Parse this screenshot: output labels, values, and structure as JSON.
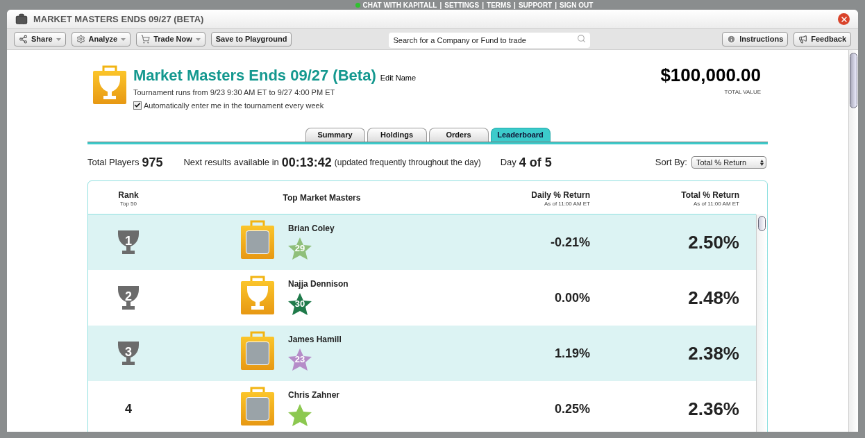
{
  "top_links": [
    "CHAT WITH KAPITALL",
    "SETTINGS",
    "TERMS",
    "SUPPORT",
    "SIGN OUT"
  ],
  "top_links_separator": "|",
  "window": {
    "title": "MARKET MASTERS ENDS 09/27 (BETA)"
  },
  "toolbar": {
    "buttons": [
      {
        "label": "Share",
        "kind": "share",
        "menu": true
      },
      {
        "label": "Analyze",
        "kind": "analyze",
        "menu": true
      },
      {
        "label": "Trade Now",
        "kind": "trade",
        "menu": true
      },
      {
        "label": "Save to Playground",
        "kind": "plain",
        "menu": false
      }
    ],
    "search": {
      "placeholder": "Search for a Company or Fund to trade"
    },
    "right_buttons": [
      {
        "label": "Instructions",
        "kind": "info"
      },
      {
        "label": "Feedback",
        "kind": "feedback"
      }
    ]
  },
  "header": {
    "title": "Market Masters Ends 09/27 (Beta)",
    "edit_link": "Edit Name",
    "schedule": "Tournament runs from 9/23 9:30 AM ET to 9/27 4:00 PM ET",
    "auto_enter": {
      "label": "Automatically enter me in the tournament every week",
      "checked": true
    },
    "total_value": "$100,000.00",
    "total_value_label": "TOTAL VALUE"
  },
  "tabs": [
    {
      "label": "Summary",
      "selected": false
    },
    {
      "label": "Holdings",
      "selected": false
    },
    {
      "label": "Orders",
      "selected": false
    },
    {
      "label": "Leaderboard",
      "selected": true
    }
  ],
  "stats": {
    "players_label": "Total Players",
    "players": "975",
    "next_label": "Next results available in",
    "countdown": "00:13:42",
    "note": "(updated frequently throughout the day)",
    "day_label": "Day",
    "day": "4 of 5",
    "sort_label": "Sort By:",
    "sort_value": "Total % Return"
  },
  "table": {
    "columns": [
      {
        "title": "Rank",
        "subtitle": "Top 50"
      },
      {
        "title": "Top Market Masters"
      },
      {
        "title": "Daily % Return",
        "subtitle": "As of 11:00 AM ET"
      },
      {
        "title": "Total % Return",
        "subtitle": "As of 11:00 AM ET"
      }
    ],
    "rows": [
      {
        "rank": {
          "kind": "trophy",
          "text": "1"
        },
        "avatar": {
          "kind": "photo"
        },
        "name": "Brian Coley",
        "level": "29",
        "color": "#8fbf7a",
        "daily": "-0.21%",
        "total": "2.50%"
      },
      {
        "rank": {
          "kind": "trophy",
          "text": "2"
        },
        "avatar": {
          "kind": "trophy"
        },
        "name": "Najja Dennison",
        "level": "30",
        "color": "#1f7a4a",
        "daily": "0.00%",
        "total": "2.48%"
      },
      {
        "rank": {
          "kind": "trophy",
          "text": "3"
        },
        "avatar": {
          "kind": "photo"
        },
        "name": "James Hamill",
        "level": "23",
        "color": "#b58cc8",
        "daily": "1.19%",
        "total": "2.38%"
      },
      {
        "rank": {
          "kind": "plain",
          "text": "4"
        },
        "avatar": {
          "kind": "photo"
        },
        "name": "Chris Zahner",
        "color": "#8cc850",
        "daily": "0.25%",
        "total": "2.36%"
      }
    ]
  }
}
